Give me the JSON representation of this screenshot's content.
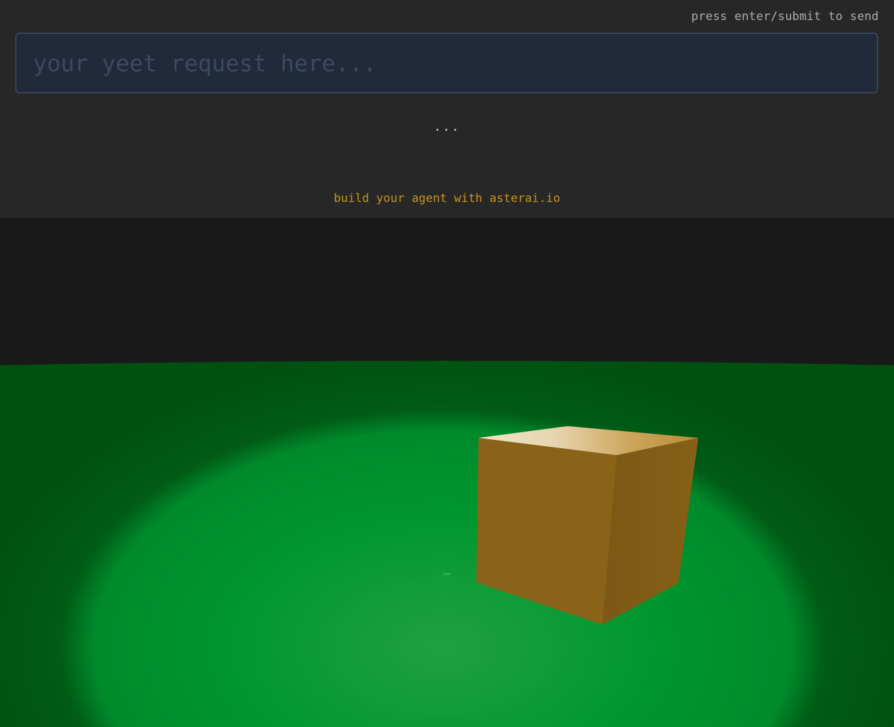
{
  "header": {
    "hint": "press enter/submit to send"
  },
  "prompt": {
    "value": "",
    "placeholder": "your yeet request here..."
  },
  "status": {
    "loading": "..."
  },
  "promo": {
    "link_text": "build your agent with asterai.io"
  },
  "scene": {
    "sky_color": "#191919",
    "ground_color": "#00962e",
    "ground_dark_color": "#005212",
    "cube_color": "#8a6318",
    "cube_top_color": "#c8a04a"
  }
}
